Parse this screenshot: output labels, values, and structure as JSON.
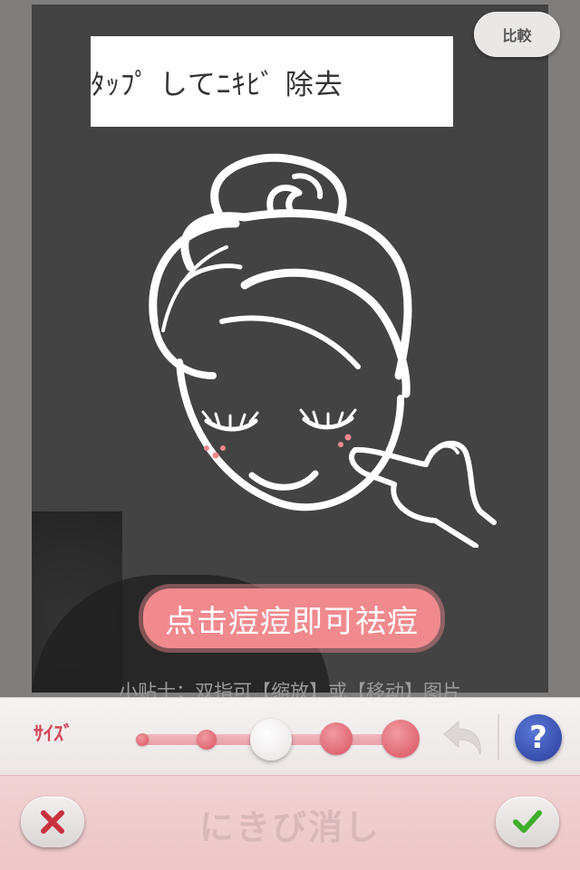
{
  "overlay": {
    "title_banner": "ﾀｯﾌﾟ してﾆｷﾋﾞ 除去",
    "compare_label": "比較",
    "hint_banner": "点击痘痘即可祛痘",
    "tip": "小贴士：双指可【缩放】或【移动】图片"
  },
  "toolbar": {
    "size_label": "ｻｲｽﾞ",
    "brush_sizes": [
      "xs",
      "s",
      "m",
      "l",
      "xl"
    ],
    "selected_size_index": 2,
    "help_label": "?"
  },
  "bottombar": {
    "title": "にきび消し"
  },
  "icons": {
    "cancel": "close-x-icon",
    "confirm": "checkmark-icon",
    "undo": "undo-arrow-icon",
    "help": "question-icon"
  },
  "colors": {
    "accent_pink": "#f08a8e",
    "size_label_red": "#d24a5b",
    "help_blue": "#2a3f9a",
    "confirm_green": "#3fae2a",
    "cancel_red": "#c8323f"
  }
}
